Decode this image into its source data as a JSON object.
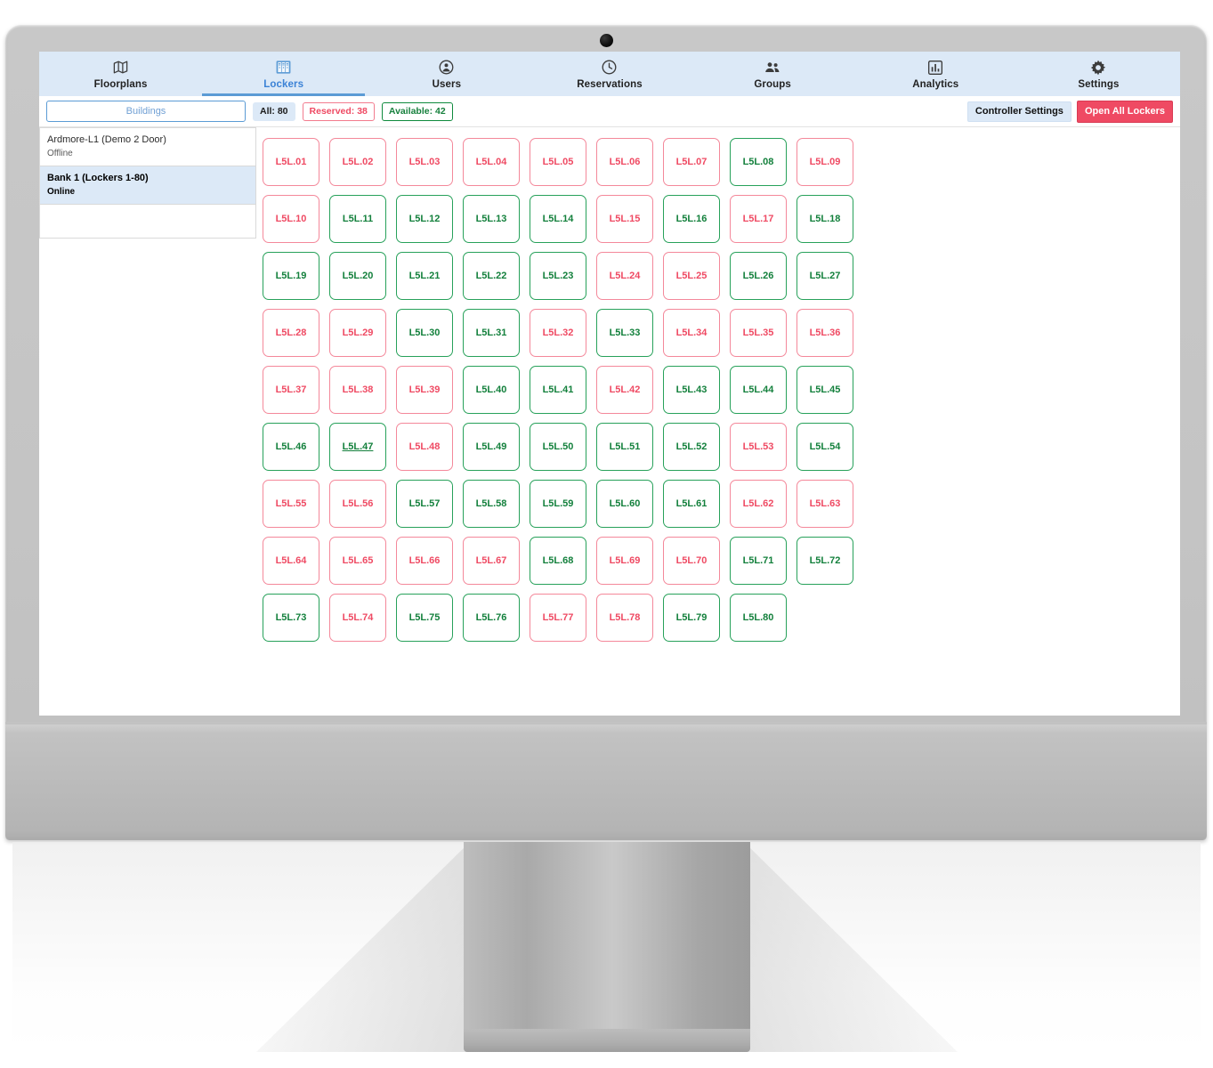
{
  "nav": {
    "items": [
      {
        "label": "Floorplans",
        "icon": "map-icon",
        "active": false
      },
      {
        "label": "Lockers",
        "icon": "lockers-icon",
        "active": true
      },
      {
        "label": "Users",
        "icon": "user-icon",
        "active": false
      },
      {
        "label": "Reservations",
        "icon": "clock-icon",
        "active": false
      },
      {
        "label": "Groups",
        "icon": "groups-icon",
        "active": false
      },
      {
        "label": "Analytics",
        "icon": "bar-chart-icon",
        "active": false
      },
      {
        "label": "Settings",
        "icon": "gear-icon",
        "active": false
      }
    ]
  },
  "toolbar": {
    "buildings_label": "Buildings",
    "chip_all": "All: 80",
    "chip_reserved": "Reserved: 38",
    "chip_available": "Available: 42",
    "controller_settings_label": "Controller Settings",
    "open_all_lockers_label": "Open All Lockers"
  },
  "sidebar": {
    "banks": [
      {
        "name": "Ardmore-L1 (Demo 2 Door)",
        "status": "Offline",
        "selected": false
      },
      {
        "name": "Bank 1 (Lockers 1-80)",
        "status": "Online",
        "selected": true
      }
    ]
  },
  "colors": {
    "accent_blue": "#5b9bd5",
    "nav_background": "#dce9f7",
    "reserved_red": "#ef4a63",
    "reserved_border": "#f4889a",
    "available_green": "#13803c",
    "available_border": "#27a15a"
  },
  "lockers": [
    {
      "label": "L5L.01",
      "state": "reserved"
    },
    {
      "label": "L5L.02",
      "state": "reserved"
    },
    {
      "label": "L5L.03",
      "state": "reserved"
    },
    {
      "label": "L5L.04",
      "state": "reserved"
    },
    {
      "label": "L5L.05",
      "state": "reserved"
    },
    {
      "label": "L5L.06",
      "state": "reserved"
    },
    {
      "label": "L5L.07",
      "state": "reserved"
    },
    {
      "label": "L5L.08",
      "state": "available"
    },
    {
      "label": "L5L.09",
      "state": "reserved"
    },
    {
      "label": "L5L.10",
      "state": "reserved"
    },
    {
      "label": "L5L.11",
      "state": "available"
    },
    {
      "label": "L5L.12",
      "state": "available"
    },
    {
      "label": "L5L.13",
      "state": "available"
    },
    {
      "label": "L5L.14",
      "state": "available"
    },
    {
      "label": "L5L.15",
      "state": "reserved"
    },
    {
      "label": "L5L.16",
      "state": "available"
    },
    {
      "label": "L5L.17",
      "state": "reserved"
    },
    {
      "label": "L5L.18",
      "state": "available"
    },
    {
      "label": "L5L.19",
      "state": "available"
    },
    {
      "label": "L5L.20",
      "state": "available"
    },
    {
      "label": "L5L.21",
      "state": "available"
    },
    {
      "label": "L5L.22",
      "state": "available"
    },
    {
      "label": "L5L.23",
      "state": "available"
    },
    {
      "label": "L5L.24",
      "state": "reserved"
    },
    {
      "label": "L5L.25",
      "state": "reserved"
    },
    {
      "label": "L5L.26",
      "state": "available"
    },
    {
      "label": "L5L.27",
      "state": "available"
    },
    {
      "label": "L5L.28",
      "state": "reserved"
    },
    {
      "label": "L5L.29",
      "state": "reserved"
    },
    {
      "label": "L5L.30",
      "state": "available"
    },
    {
      "label": "L5L.31",
      "state": "available"
    },
    {
      "label": "L5L.32",
      "state": "reserved"
    },
    {
      "label": "L5L.33",
      "state": "available"
    },
    {
      "label": "L5L.34",
      "state": "reserved"
    },
    {
      "label": "L5L.35",
      "state": "reserved"
    },
    {
      "label": "L5L.36",
      "state": "reserved"
    },
    {
      "label": "L5L.37",
      "state": "reserved"
    },
    {
      "label": "L5L.38",
      "state": "reserved"
    },
    {
      "label": "L5L.39",
      "state": "reserved"
    },
    {
      "label": "L5L.40",
      "state": "available"
    },
    {
      "label": "L5L.41",
      "state": "available"
    },
    {
      "label": "L5L.42",
      "state": "reserved"
    },
    {
      "label": "L5L.43",
      "state": "available"
    },
    {
      "label": "L5L.44",
      "state": "available"
    },
    {
      "label": "L5L.45",
      "state": "available"
    },
    {
      "label": "L5L.46",
      "state": "available"
    },
    {
      "label": "L5L.47",
      "state": "hover"
    },
    {
      "label": "L5L.48",
      "state": "reserved"
    },
    {
      "label": "L5L.49",
      "state": "available"
    },
    {
      "label": "L5L.50",
      "state": "available"
    },
    {
      "label": "L5L.51",
      "state": "available"
    },
    {
      "label": "L5L.52",
      "state": "available"
    },
    {
      "label": "L5L.53",
      "state": "reserved"
    },
    {
      "label": "L5L.54",
      "state": "available"
    },
    {
      "label": "L5L.55",
      "state": "reserved"
    },
    {
      "label": "L5L.56",
      "state": "reserved"
    },
    {
      "label": "L5L.57",
      "state": "available"
    },
    {
      "label": "L5L.58",
      "state": "available"
    },
    {
      "label": "L5L.59",
      "state": "available"
    },
    {
      "label": "L5L.60",
      "state": "available"
    },
    {
      "label": "L5L.61",
      "state": "available"
    },
    {
      "label": "L5L.62",
      "state": "reserved"
    },
    {
      "label": "L5L.63",
      "state": "reserved"
    },
    {
      "label": "L5L.64",
      "state": "reserved"
    },
    {
      "label": "L5L.65",
      "state": "reserved"
    },
    {
      "label": "L5L.66",
      "state": "reserved"
    },
    {
      "label": "L5L.67",
      "state": "reserved"
    },
    {
      "label": "L5L.68",
      "state": "available"
    },
    {
      "label": "L5L.69",
      "state": "reserved"
    },
    {
      "label": "L5L.70",
      "state": "reserved"
    },
    {
      "label": "L5L.71",
      "state": "available"
    },
    {
      "label": "L5L.72",
      "state": "available"
    },
    {
      "label": "L5L.73",
      "state": "available"
    },
    {
      "label": "L5L.74",
      "state": "reserved"
    },
    {
      "label": "L5L.75",
      "state": "available"
    },
    {
      "label": "L5L.76",
      "state": "available"
    },
    {
      "label": "L5L.77",
      "state": "reserved"
    },
    {
      "label": "L5L.78",
      "state": "reserved"
    },
    {
      "label": "L5L.79",
      "state": "available"
    },
    {
      "label": "L5L.80",
      "state": "available"
    }
  ]
}
